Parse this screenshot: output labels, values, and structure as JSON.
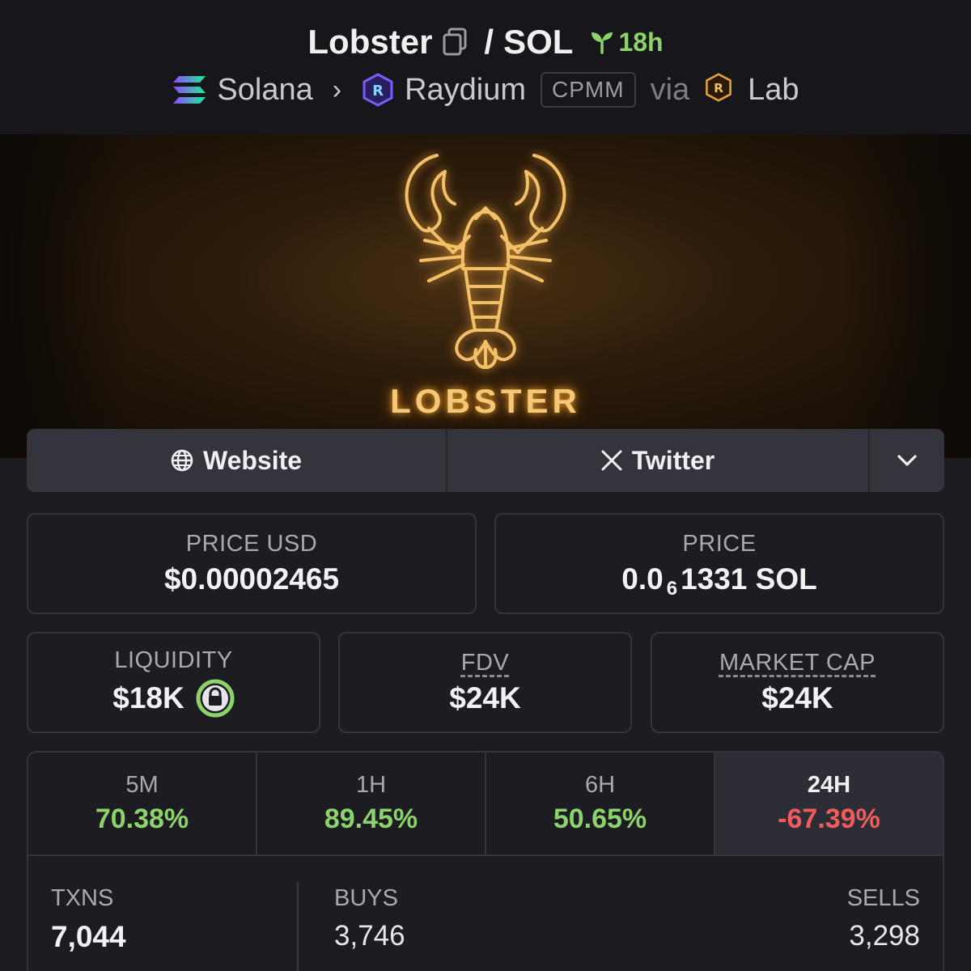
{
  "header": {
    "token_name": "Lobster",
    "separator": "/",
    "quote_symbol": "SOL",
    "age": "18h",
    "chain": "Solana",
    "dex": "Raydium",
    "pool_type": "CPMM",
    "via_label": "via",
    "launchpad": "Lab"
  },
  "banner": {
    "text": "LOBSTER"
  },
  "links": {
    "website": "Website",
    "twitter": "Twitter"
  },
  "stats": {
    "price_usd_label": "PRICE USD",
    "price_usd_value": "$0.00002465",
    "price_label": "PRICE",
    "price_prefix": "0.0",
    "price_zero_count": "6",
    "price_suffix": "1331 SOL",
    "liquidity_label": "LIQUIDITY",
    "liquidity_value": "$18K",
    "fdv_label": "FDV",
    "fdv_value": "$24K",
    "mcap_label": "MARKET CAP",
    "mcap_value": "$24K"
  },
  "timeframes": [
    {
      "label": "5M",
      "value": "70.38%"
    },
    {
      "label": "1H",
      "value": "89.45%"
    },
    {
      "label": "6H",
      "value": "50.65%"
    },
    {
      "label": "24H",
      "value": "-67.39%"
    }
  ],
  "txns": {
    "txns_label": "TXNS",
    "txns_value": "7,044",
    "buys_label": "BUYS",
    "buys_value": "3,746",
    "sells_label": "SELLS",
    "sells_value": "3,298"
  },
  "colors": {
    "positive": "#8bd36a",
    "negative": "#f05b5b",
    "banner_glow": "#f5c878"
  }
}
